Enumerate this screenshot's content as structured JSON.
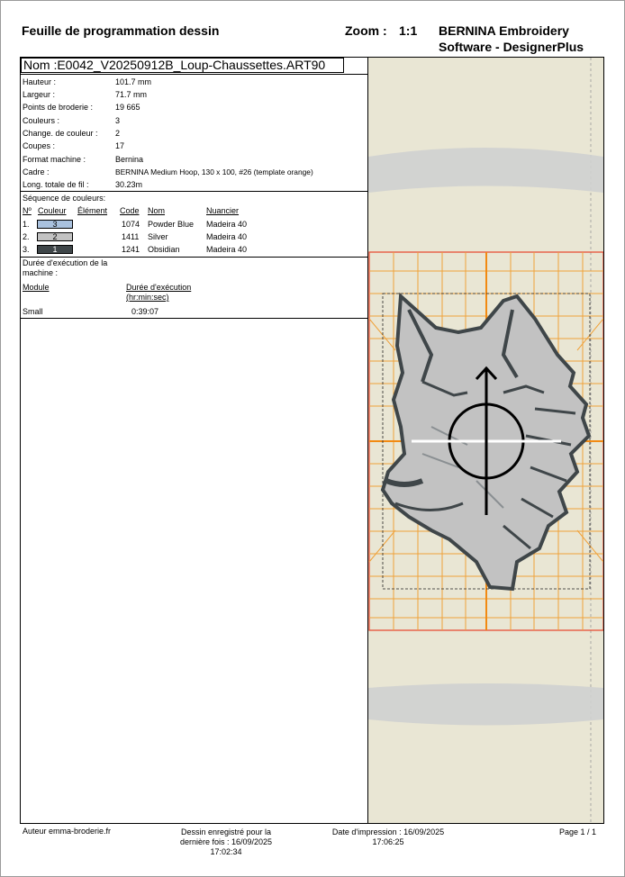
{
  "header": {
    "title": "Feuille de programmation dessin",
    "zoom_label": "Zoom :",
    "zoom_value": "1:1",
    "software_line1": "BERNINA Embroidery",
    "software_line2": "Software - DesignerPlus"
  },
  "design_name": "Nom :E0042_V20250912B_Loup-Chaussettes.ART90",
  "properties": [
    {
      "label": "Hauteur :",
      "value": "101.7 mm"
    },
    {
      "label": "Largeur :",
      "value": "71.7 mm"
    },
    {
      "label": "Points de broderie :",
      "value": "19 665"
    },
    {
      "label": "Couleurs :",
      "value": "3"
    },
    {
      "label": "Change. de couleur :",
      "value": "2"
    },
    {
      "label": "Coupes :",
      "value": "17"
    },
    {
      "label": "Format machine :",
      "value": "Bernina"
    },
    {
      "label": "Cadre :",
      "value": "BERNINA Medium Hoop, 130 x 100, #26 (template orange)"
    },
    {
      "label": "Long. totale de fil :",
      "value": "30.23m"
    }
  ],
  "color_sequence": {
    "title": "Séquence de couleurs:",
    "headers": {
      "num": "Nº",
      "couleur": "Couleur",
      "element": "Élément",
      "code": "Code",
      "nom": "Nom",
      "nuancier": "Nuancier"
    },
    "rows": [
      {
        "num": "1.",
        "swatch_label": "3",
        "swatch_color": "#a9c1de",
        "code": "1074",
        "nom": "Powder Blue",
        "nuancier": "Madeira 40"
      },
      {
        "num": "2.",
        "swatch_label": "2",
        "swatch_color": "#c2c2c2",
        "code": "1411",
        "nom": "Silver",
        "nuancier": "Madeira 40"
      },
      {
        "num": "3.",
        "swatch_label": "1",
        "swatch_color": "#3f4649",
        "code": "1241",
        "nom": "Obsidian",
        "nuancier": "Madeira 40"
      }
    ]
  },
  "runtime": {
    "title_line1": "Durée d'exécution de la",
    "title_line2": "machine :",
    "col_module": "Module",
    "col_duration_line1": "Durée d'exécution",
    "col_duration_line2": "(hr:min:sec)",
    "module": "Small",
    "duration": "0:39:07"
  },
  "footer": {
    "author": "Auteur emma-broderie.fr",
    "saved_line1": "Dessin enregistré pour la",
    "saved_line2": "dernière fois : 16/09/2025",
    "saved_line3": "17:02:34",
    "printed_line1": "Date d'impression : 16/09/2025",
    "printed_line2": "17:06:25",
    "page": "Page 1 / 1"
  },
  "colors": {
    "hoop_grid": "#f0a23a",
    "hoop_axis": "#f28a12",
    "hoop_border": "#e8432a",
    "background": "#e9e6d4",
    "sock_band": "#cfd0d0"
  }
}
